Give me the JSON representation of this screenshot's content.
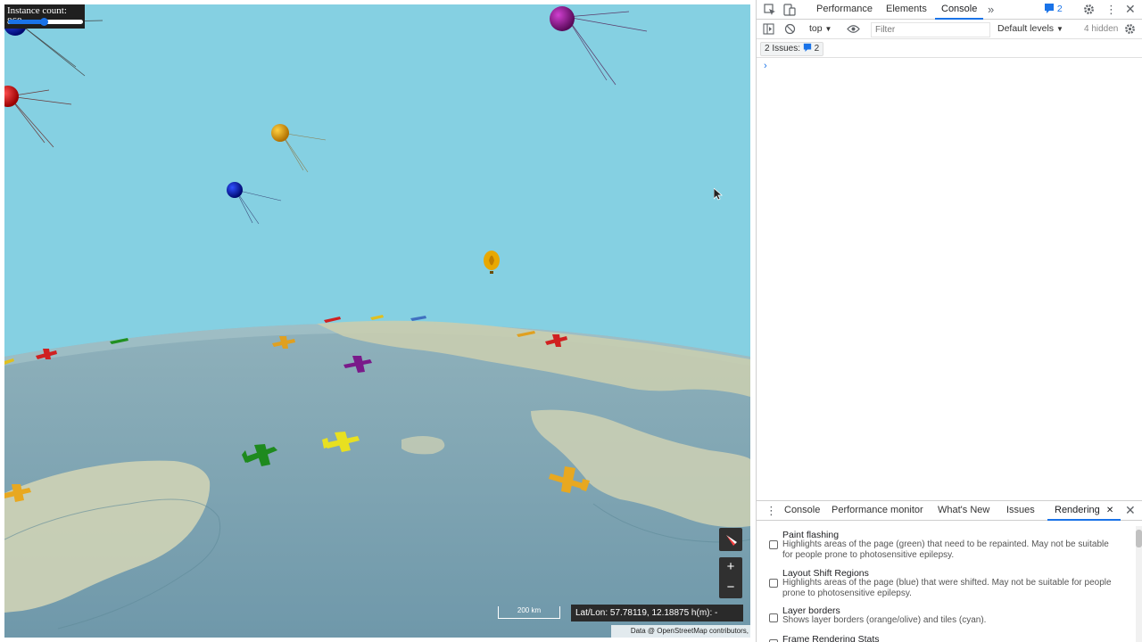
{
  "map": {
    "instance_label": "Instance count: 868",
    "instance_fraction": 0.48,
    "scale_label": "200 km",
    "coords_text": "Lat/Lon: 57.78119, 12.18875 h(m): -",
    "attribution": "Data @ OpenStreetMap contributors, ODbL",
    "zoom_in": "+",
    "zoom_out": "−",
    "colors": {
      "sky": "#85d0e2",
      "sea": "#7fa7b7",
      "land": "#d6d8b8"
    }
  },
  "devtools": {
    "tabs": [
      "Performance",
      "Elements",
      "Console"
    ],
    "active_tab": "Console",
    "more_tabs_icon": "chevron-double-right-icon",
    "messages_count": "2",
    "context": "top",
    "filter_placeholder": "Filter",
    "levels": "Default levels",
    "hidden": "4 hidden",
    "issues_label": "2 Issues:",
    "issues_count": "2",
    "prompt": "›",
    "drawer_tabs": [
      "Console",
      "Performance monitor",
      "What's New",
      "Issues",
      "Rendering"
    ],
    "active_drawer_tab": "Rendering",
    "rendering_options": [
      {
        "title": "Paint flashing",
        "desc": "Highlights areas of the page (green) that need to be repainted. May not be suitable for people prone to photosensitive epilepsy."
      },
      {
        "title": "Layout Shift Regions",
        "desc": "Highlights areas of the page (blue) that were shifted. May not be suitable for people prone to photosensitive epilepsy."
      },
      {
        "title": "Layer borders",
        "desc": "Shows layer borders (orange/olive) and tiles (cyan)."
      },
      {
        "title": "Frame Rendering Stats",
        "desc": ""
      }
    ]
  }
}
